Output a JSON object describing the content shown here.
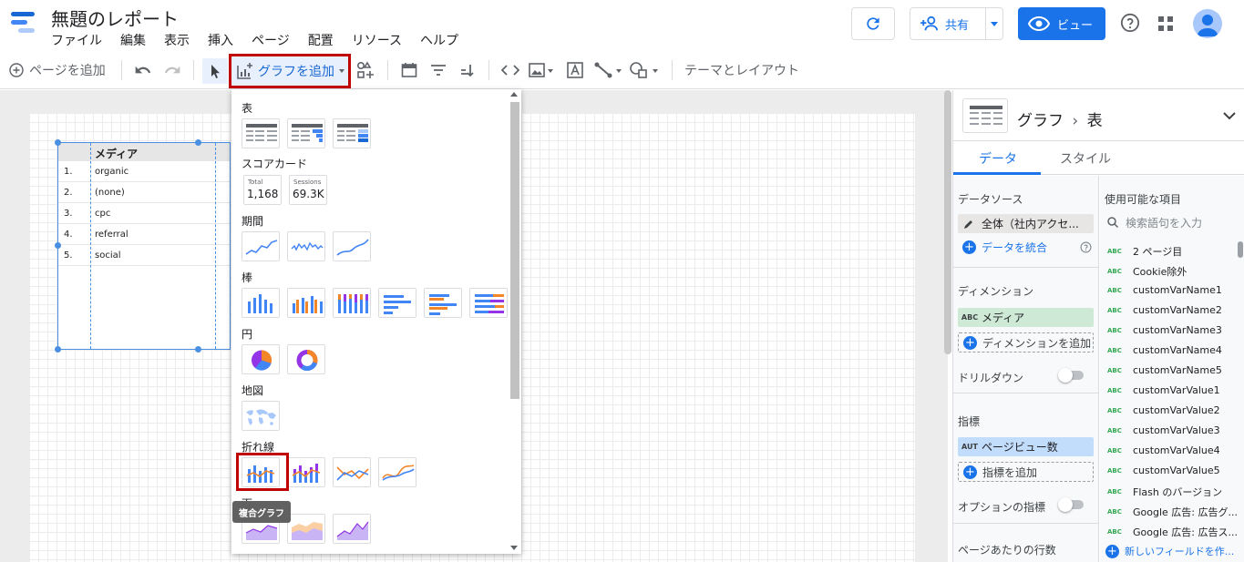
{
  "header": {
    "title": "無題のレポート",
    "menu": [
      "ファイル",
      "編集",
      "表示",
      "挿入",
      "ページ",
      "配置",
      "リソース",
      "ヘルプ"
    ],
    "share_label": "共有",
    "view_label": "ビュー",
    "brand_colors": {
      "logo_blue_dark": "#1967d2",
      "logo_blue": "#4285f4",
      "logo_blue_light": "#aecbfa"
    }
  },
  "toolbar": {
    "add_page": "ページを追加",
    "add_chart": "グラフを追加",
    "theme_layout": "テーマとレイアウト"
  },
  "table_widget": {
    "header": "メディア",
    "rows": [
      {
        "num": "1.",
        "value": "organic"
      },
      {
        "num": "2.",
        "value": "(none)"
      },
      {
        "num": "3.",
        "value": "cpc"
      },
      {
        "num": "4.",
        "value": "referral"
      },
      {
        "num": "5.",
        "value": "social"
      }
    ]
  },
  "chart_menu": {
    "sections": {
      "table": "表",
      "scorecard": "スコアカード",
      "timeseries": "期間",
      "bar": "棒",
      "pie": "円",
      "geo": "地図",
      "line": "折れ線",
      "area": "面"
    },
    "scorecards": [
      {
        "title": "Total",
        "value": "1,168"
      },
      {
        "title": "Sessions",
        "value": "69.3K"
      }
    ],
    "tooltip": "複合グラフ",
    "colors": {
      "blue": "#4285f4",
      "orange": "#f4862a",
      "purple": "#9334e6",
      "lavender": "#c9b5f5"
    }
  },
  "panel": {
    "title_part1": "グラフ",
    "title_part2": "表",
    "tabs": [
      "データ",
      "スタイル"
    ],
    "data_source_label": "データソース",
    "data_source_value": "全体（社内アクセ...",
    "blend_data": "データを統合",
    "dimension_label": "ディメンション",
    "dimension_value": "メディア",
    "dimension_tag": "ABC",
    "add_dimension": "ディメンションを追加",
    "drilldown": "ドリルダウン",
    "metric_label": "指標",
    "metric_value": "ページビュー数",
    "metric_tag": "AUT",
    "add_metric": "指標を追加",
    "optional_metrics": "オプションの指標",
    "rows_per_page": "ページあたりの行数",
    "available_fields": "使用可能な項目",
    "search_placeholder": "検索語句を入力",
    "field_tag": "ABC",
    "fields": [
      "2 ページ目",
      "Cookie除外",
      "customVarName1",
      "customVarName2",
      "customVarName3",
      "customVarName4",
      "customVarName5",
      "customVarValue1",
      "customVarValue2",
      "customVarValue3",
      "customVarValue4",
      "customVarValue5",
      "Flash のバージョン",
      "Google 広告: 広告グ...",
      "Google 広告: 広告ス..."
    ],
    "new_field": "新しいフィールドを作..."
  }
}
